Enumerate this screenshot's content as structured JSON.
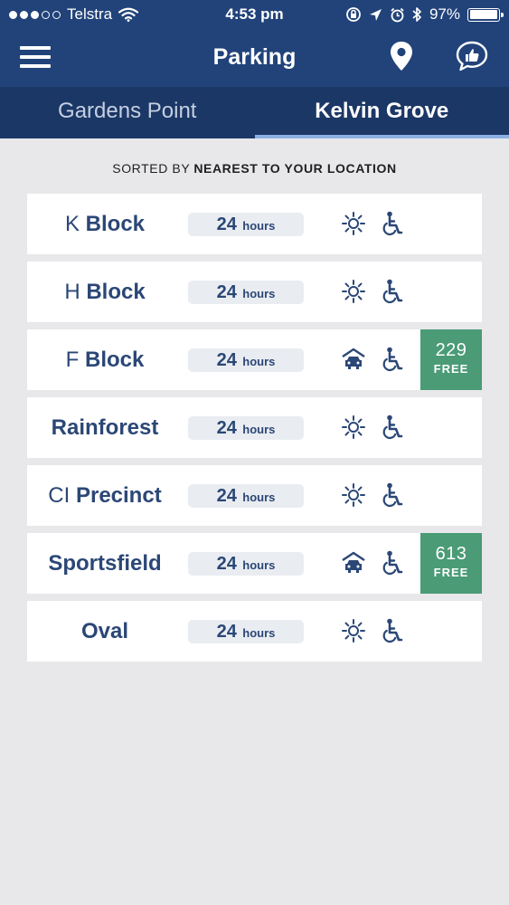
{
  "status_bar": {
    "carrier": "Telstra",
    "time": "4:53 pm",
    "battery": "97%",
    "battery_level": 0.97,
    "signal_bars_filled": 3,
    "signal_bars_total": 5
  },
  "header": {
    "title": "Parking",
    "menu_icon": "hamburger-menu-icon",
    "location_icon": "map-pin-icon",
    "feedback_icon": "thumbs-up-bubble-icon"
  },
  "tabs": [
    {
      "label": "Gardens Point",
      "active": false
    },
    {
      "label": "Kelvin Grove",
      "active": true
    }
  ],
  "sort": {
    "prefix": "SORTED BY",
    "value": "NEAREST TO YOUR LOCATION"
  },
  "carparks": [
    {
      "name_prefix": "K",
      "name": "Block",
      "hours": "24",
      "hours_unit": "hours",
      "type_icon": "sun-icon",
      "accessible_icon": "wheelchair-icon",
      "free_count": "",
      "free_label": ""
    },
    {
      "name_prefix": "H",
      "name": "Block",
      "hours": "24",
      "hours_unit": "hours",
      "type_icon": "sun-icon",
      "accessible_icon": "wheelchair-icon",
      "free_count": "",
      "free_label": ""
    },
    {
      "name_prefix": "F",
      "name": "Block",
      "hours": "24",
      "hours_unit": "hours",
      "type_icon": "covered-car-icon",
      "accessible_icon": "wheelchair-icon",
      "free_count": "229",
      "free_label": "FREE"
    },
    {
      "name_prefix": "",
      "name": "Rainforest",
      "hours": "24",
      "hours_unit": "hours",
      "type_icon": "sun-icon",
      "accessible_icon": "wheelchair-icon",
      "free_count": "",
      "free_label": ""
    },
    {
      "name_prefix": "CI",
      "name": "Precinct",
      "hours": "24",
      "hours_unit": "hours",
      "type_icon": "sun-icon",
      "accessible_icon": "wheelchair-icon",
      "free_count": "",
      "free_label": ""
    },
    {
      "name_prefix": "",
      "name": "Sportsfield",
      "hours": "24",
      "hours_unit": "hours",
      "type_icon": "covered-car-icon",
      "accessible_icon": "wheelchair-icon",
      "free_count": "613",
      "free_label": "FREE"
    },
    {
      "name_prefix": "",
      "name": "Oval",
      "hours": "24",
      "hours_unit": "hours",
      "type_icon": "sun-icon",
      "accessible_icon": "wheelchair-icon",
      "free_count": "",
      "free_label": ""
    }
  ],
  "colors": {
    "header_bg": "#21437a",
    "tab_bar_bg": "#1b3766",
    "tab_indicator": "#8ab0e3",
    "text_navy": "#2b4776",
    "free_badge_bg": "#4a9b76",
    "page_bg": "#e8e8ea"
  }
}
